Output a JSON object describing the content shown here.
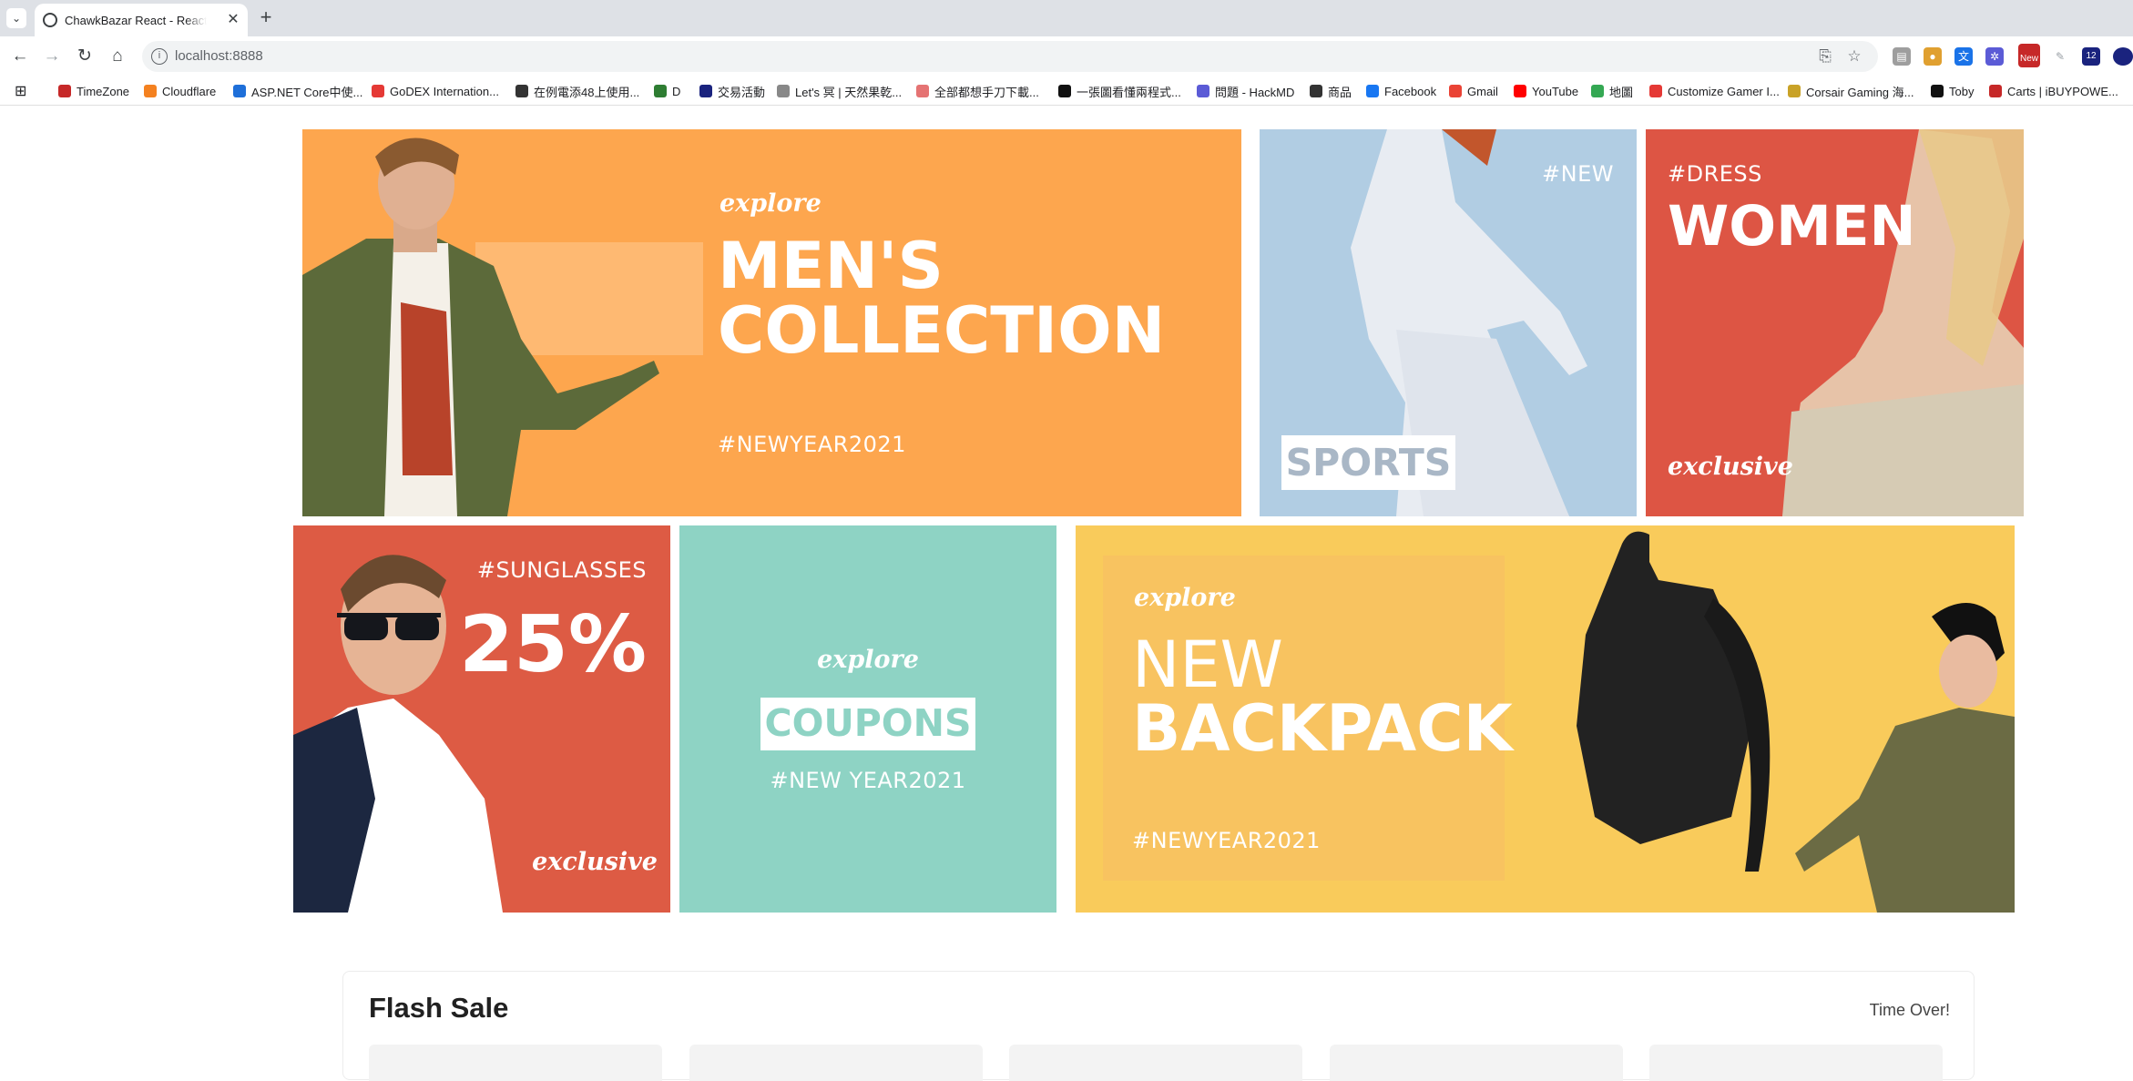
{
  "browser": {
    "tab_title": "ChawkBazar React - React Next",
    "url": "localhost:8888",
    "bookmarks": [
      "TimeZone",
      "Cloudflare",
      "ASP.NET Core中使...",
      "GoDEX Internation...",
      "在例電添48上使用...",
      "D",
      "交易活動",
      "Let's 冥 | 天然果乾...",
      "全部都想手刀下載...",
      "一張圖看懂兩程式...",
      "問題 - HackMD",
      "商品",
      "Facebook",
      "Gmail",
      "YouTube",
      "地圖",
      "Customize Gamer I...",
      "Corsair Gaming 海...",
      "Toby",
      "Carts | iBUYPOWE..."
    ],
    "bookmark_colors": [
      "#c62828",
      "#f48120",
      "#1e6fd9",
      "#e53935",
      "#333333",
      "#2e7d32",
      "#1a237e",
      "#888888",
      "#e57373",
      "#111111",
      "#5b5bd6",
      "#333333",
      "#1877f2",
      "#ea4335",
      "#ff0000",
      "#34a853",
      "#e53935",
      "#c9a227",
      "#111111",
      "#c62828"
    ],
    "new_badge": "New",
    "ext_count": "12"
  },
  "banners": {
    "mens": {
      "explore": "explore",
      "line1": "MEN'S",
      "line2": "COLLECTION",
      "tag": "#NEWYEAR2021",
      "bg": "#fda64e"
    },
    "sports": {
      "tag": "#NEW",
      "label": "SPORTS",
      "bg": "#b1cde3"
    },
    "women": {
      "tag": "#DRESS",
      "title": "WOMEN",
      "script": "exclusive",
      "bg": "#dd5544"
    },
    "sunglasses": {
      "tag": "#SUNGLASSES",
      "percent": "25%",
      "script": "exclusive",
      "bg": "#dd5b44"
    },
    "coupons": {
      "explore": "explore",
      "label": "COUPONS",
      "tag": "#NEW YEAR2021",
      "bg": "#8ed3c4"
    },
    "backpack": {
      "explore": "explore",
      "line1": "NEW",
      "line2": "BACKPACK",
      "tag": "#NEWYEAR2021",
      "bg": "#f9cb5b"
    }
  },
  "flash_sale": {
    "title": "Flash Sale",
    "status": "Time Over!"
  }
}
